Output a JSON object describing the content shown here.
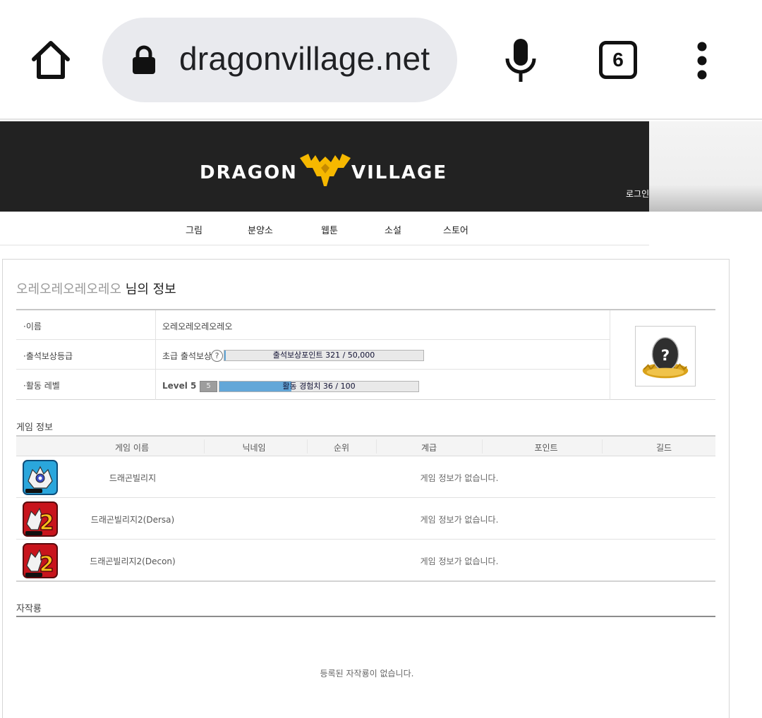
{
  "browser": {
    "url": "dragonvillage.net",
    "tab_count": "6",
    "icons": {
      "home": "home-icon",
      "lock": "lock-icon",
      "mic": "microphone-icon",
      "menu": "more-vert-icon"
    }
  },
  "site": {
    "logo": {
      "left": "DRAGON",
      "right": "VILLAGE"
    },
    "login": "로그인",
    "nav": [
      "그림",
      "분양소",
      "웹툰",
      "소설",
      "스토어"
    ],
    "colors": {
      "header": "#222222",
      "accent": "#f6b800",
      "bar_fill": "#63a7d8"
    }
  },
  "profile": {
    "username": "오레오레오레오레오",
    "title_suffix": " 님의 정보",
    "rows": {
      "name": {
        "label": "·이름",
        "value": "오레오레오레오레오"
      },
      "attendance": {
        "label": "·출석보상등급",
        "grade": "초급 출석보상",
        "help": "?",
        "bar_text": "출석보상포인트 321 / 50,000",
        "progress": 0.0064
      },
      "activity": {
        "label": "·활동 레벨",
        "level": "Level 5",
        "badge": "5",
        "bar_text": "활동 경험치 36 / 100",
        "progress": 0.36
      }
    },
    "avatar_icon": "egg-nest-icon"
  },
  "game_info": {
    "section_title": "게임 정보",
    "columns": [
      "게임 이름",
      "닉네임",
      "순위",
      "계급",
      "포인트",
      "길드"
    ],
    "rows": [
      {
        "name": "드래곤빌리지",
        "status": "게임 정보가 없습니다.",
        "icon": "dragon-village-game-icon"
      },
      {
        "name": "드래곤빌리지2(Dersa)",
        "status": "게임 정보가 없습니다.",
        "icon": "dragon-village-2-game-icon"
      },
      {
        "name": "드래곤빌리지2(Decon)",
        "status": "게임 정보가 없습니다.",
        "icon": "dragon-village-2-game-icon"
      }
    ]
  },
  "works": {
    "section_title": "자작룡",
    "empty": "등록된 자작룡이 없습니다."
  }
}
